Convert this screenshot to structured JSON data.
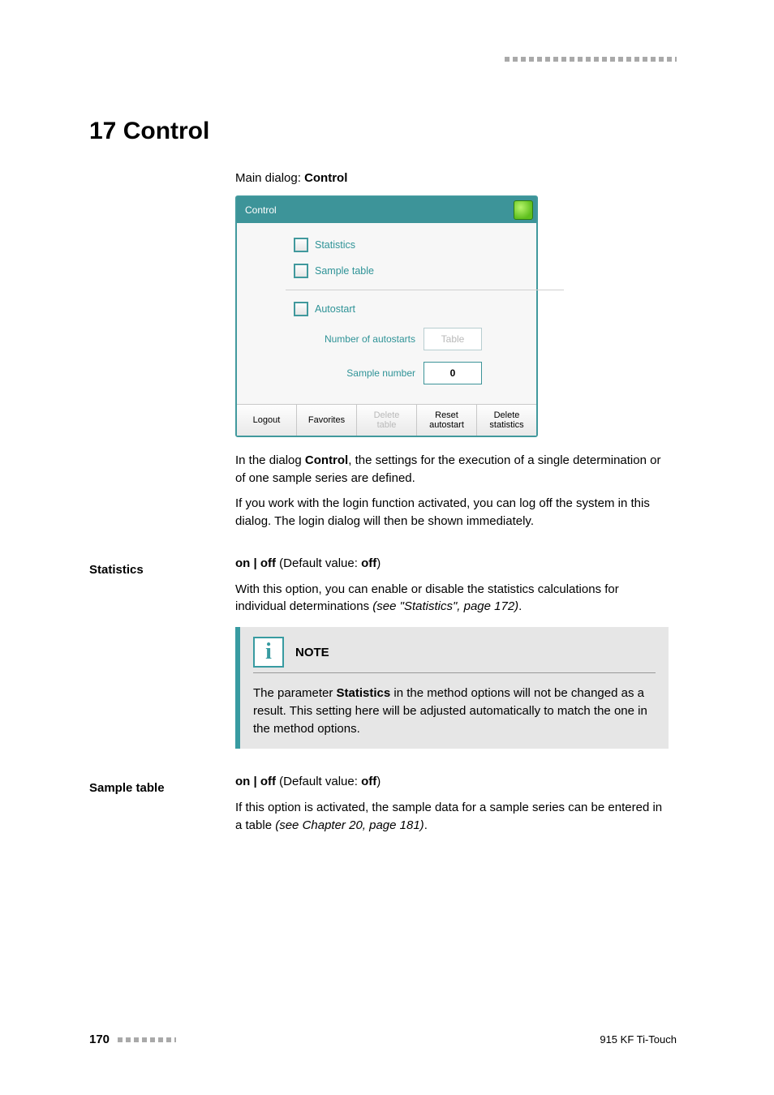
{
  "header": {},
  "chapter": {
    "title": "17 Control"
  },
  "main_dialog_line": {
    "prefix": "Main dialog: ",
    "bold": "Control"
  },
  "mock": {
    "title": "Control",
    "checkboxes": {
      "statistics": "Statistics",
      "sample_table": "Sample table",
      "autostart": "Autostart"
    },
    "fields": {
      "num_autostarts": {
        "label": "Number of autostarts",
        "box": "Table",
        "disabled": true
      },
      "sample_number": {
        "label": "Sample number",
        "box": "0",
        "disabled": false
      }
    },
    "buttons": {
      "logout": "Logout",
      "favorites": "Favorites",
      "delete_table": "Delete\ntable",
      "reset_autostart": "Reset\nautostart",
      "delete_statistics": "Delete\nstatistics"
    }
  },
  "para1": {
    "pre": "In the dialog ",
    "bold": "Control",
    "post": ", the settings for the execution of a single determination or of one sample series are defined."
  },
  "para2": "If you work with the login function activated, you can log off the system in this dialog. The login dialog will then be shown immediately.",
  "statistics": {
    "heading": "Statistics",
    "onoff_prefix": "on | off",
    "default_prefix": " (Default value: ",
    "default_bold": "off",
    "default_suffix": ")",
    "body_pre": "With this option, you can enable or disable the statistics calculations for individual determinations ",
    "body_italic": "(see \"Statistics\", page 172)",
    "body_post": "."
  },
  "note": {
    "title": "NOTE",
    "body_pre": "The parameter ",
    "body_bold": "Statistics",
    "body_post": " in the method options will not be changed as a result. This setting here will be adjusted automatically to match the one in the method options."
  },
  "sample_table": {
    "heading": "Sample table",
    "onoff_prefix": "on | off",
    "default_prefix": " (Default value: ",
    "default_bold": "off",
    "default_suffix": ")",
    "body_pre": "If this option is activated, the sample data for a sample series can be entered in a table ",
    "body_italic": "(see Chapter 20, page 181)",
    "body_post": "."
  },
  "footer": {
    "page_number": "170",
    "product": "915 KF Ti-Touch"
  }
}
